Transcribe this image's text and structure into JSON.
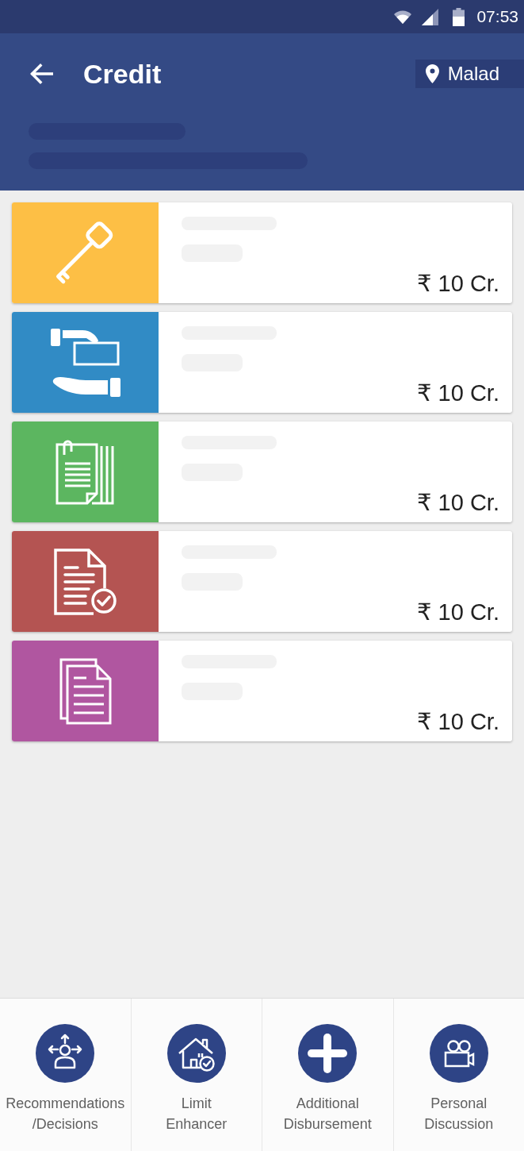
{
  "status_bar": {
    "time": "07:53"
  },
  "app_bar": {
    "title": "Credit",
    "location": "Malad"
  },
  "cards": [
    {
      "kind": "key",
      "color": "#fdbf45",
      "amount": "₹ 10 Cr."
    },
    {
      "kind": "hand-money",
      "color": "#318bc5",
      "amount": "₹ 10 Cr."
    },
    {
      "kind": "clipped-documents",
      "color": "#5cb660",
      "amount": "₹ 10 Cr."
    },
    {
      "kind": "document-check",
      "color": "#b45452",
      "amount": "₹ 10 Cr."
    },
    {
      "kind": "documents",
      "color": "#b056a0",
      "amount": "₹ 10 Cr."
    }
  ],
  "bottom_nav": [
    {
      "kind": "person-arrows",
      "label": "Recommendations\n/Decisions"
    },
    {
      "kind": "house-check",
      "label": "Limit\nEnhancer"
    },
    {
      "kind": "plus",
      "label": "Additional\nDisbursement"
    },
    {
      "kind": "video-camera",
      "label": "Personal\nDiscussion"
    }
  ]
}
